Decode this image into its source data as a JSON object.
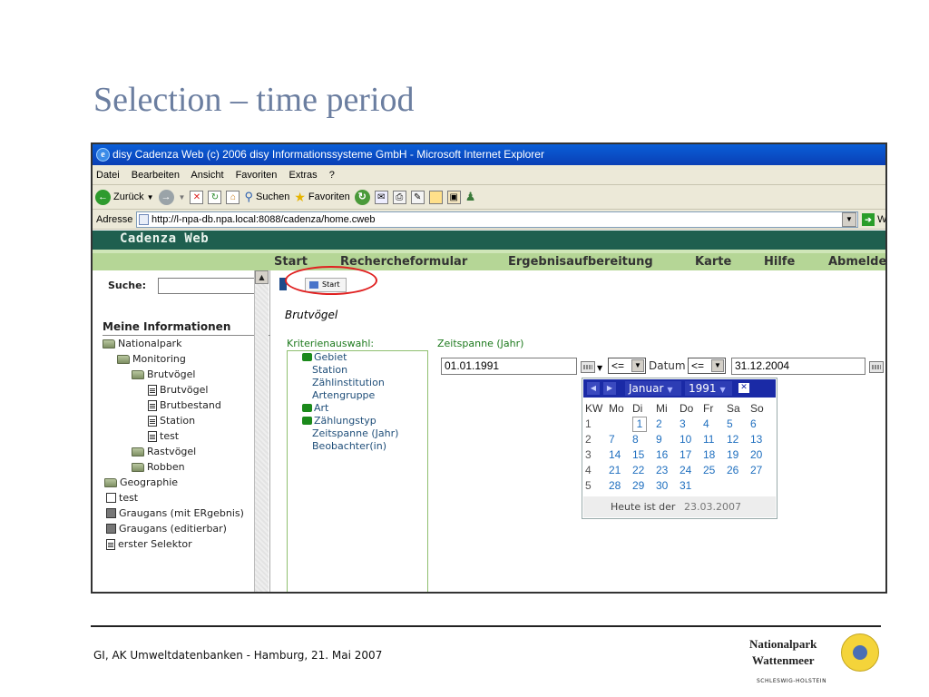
{
  "slide": {
    "title": "Selection – time period",
    "footer": "GI, AK Umweltdatenbanken - Hamburg, 21. Mai 2007",
    "logo_line1": "Nationalpark",
    "logo_line2": "Wattenmeer",
    "logo_sub": "SCHLESWIG-HOLSTEIN"
  },
  "browser": {
    "title": "disy Cadenza Web (c) 2006 disy Informationssysteme GmbH - Microsoft Internet Explorer",
    "menu": [
      "Datei",
      "Bearbeiten",
      "Ansicht",
      "Favoriten",
      "Extras",
      "?"
    ],
    "toolbar": {
      "back": "Zurück",
      "search": "Suchen",
      "favorites": "Favoriten"
    },
    "address_label": "Adresse",
    "url": "http://l-npa-db.npa.local:8088/cadenza/home.cweb",
    "go_label": "W"
  },
  "app": {
    "logo": "Cadenza Web",
    "nav": [
      "Start",
      "Rechercheformular",
      "Ergebnisaufbereitung",
      "Karte",
      "Hilfe",
      "Abmelde"
    ],
    "search_label": "Suche:",
    "meine_title": "Meine Informationen",
    "tree": [
      "Nationalpark",
      "Monitoring",
      "Brutvögel",
      "Brutvögel",
      "Brutbestand",
      "Station",
      "test",
      "Rastvögel",
      "Robben",
      "Geographie",
      "test",
      "Graugans (mit ERgebnis)",
      "Graugans (editierbar)",
      "erster Selektor"
    ],
    "start_button": "Start",
    "heading": "Brutvögel",
    "criteria_label": "Kriterienauswahl:",
    "criteria": [
      "Gebiet",
      "Station",
      "Zählinstitution",
      "Artengruppe",
      "Art",
      "Zählungstyp",
      "Zeitspanne (Jahr)",
      "Beobachter(in)"
    ],
    "time_label": "Zeitspanne (Jahr)",
    "date_from": "01.01.1991",
    "op_from": "<=",
    "datum_label": "Datum",
    "op_to": "<=",
    "date_to": "31.12.2004"
  },
  "calendar": {
    "month": "Januar",
    "year": "1991",
    "close": "✕",
    "headers": [
      "KW",
      "Mo",
      "Di",
      "Mi",
      "Do",
      "Fr",
      "Sa",
      "So"
    ],
    "weeks": [
      [
        "1",
        "",
        "1",
        "2",
        "3",
        "4",
        "5",
        "6"
      ],
      [
        "2",
        "7",
        "8",
        "9",
        "10",
        "11",
        "12",
        "13"
      ],
      [
        "3",
        "14",
        "15",
        "16",
        "17",
        "18",
        "19",
        "20"
      ],
      [
        "4",
        "21",
        "22",
        "23",
        "24",
        "25",
        "26",
        "27"
      ],
      [
        "5",
        "28",
        "29",
        "30",
        "31",
        "",
        "",
        ""
      ]
    ],
    "today_label": "Heute ist der",
    "today_date": "23.03.2007"
  }
}
